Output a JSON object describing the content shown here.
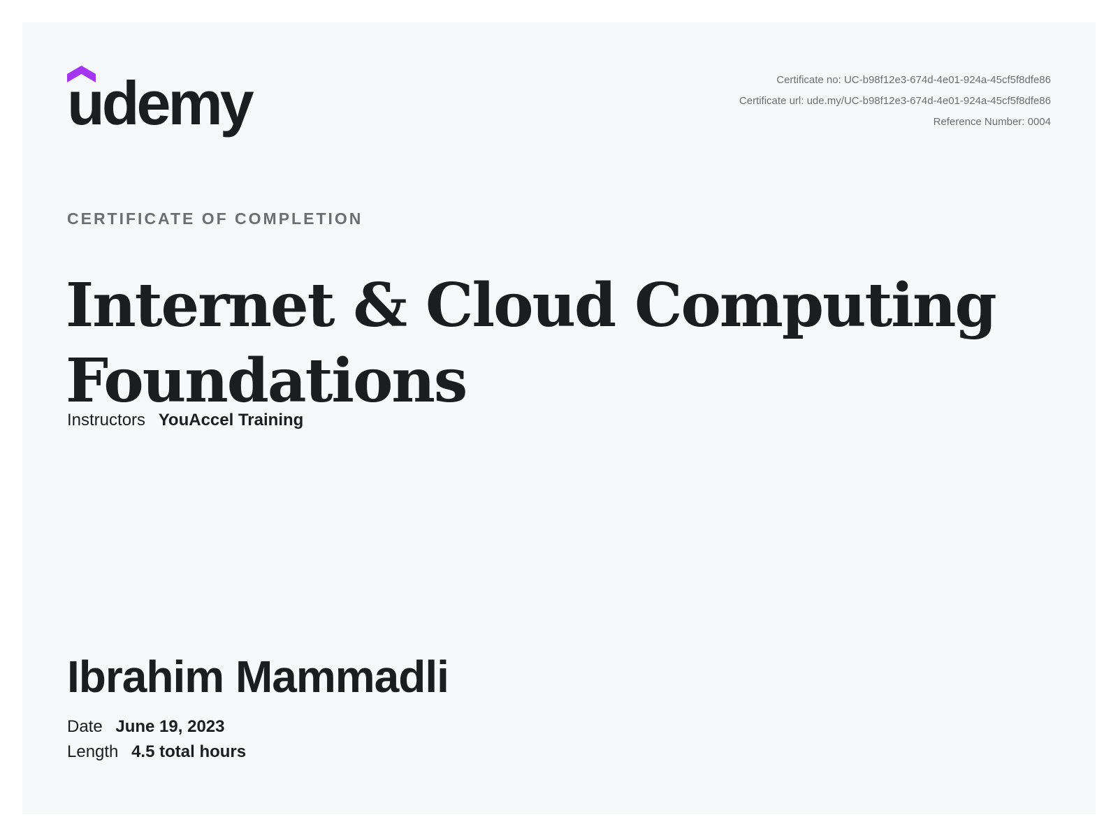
{
  "brand": {
    "logo_text": "udemy",
    "accent_color": "#a435f0"
  },
  "meta": {
    "certificate_no": "Certificate no: UC-b98f12e3-674d-4e01-924a-45cf5f8dfe86",
    "certificate_url": "Certificate url: ude.my/UC-b98f12e3-674d-4e01-924a-45cf5f8dfe86",
    "reference_number": "Reference Number: 0004"
  },
  "certificate": {
    "kicker": "CERTIFICATE OF COMPLETION",
    "course_title": "Internet & Cloud Computing Foundations",
    "instructors_label": "Instructors",
    "instructors_value": "YouAccel Training",
    "student_name": "Ibrahim Mammadli",
    "date_label": "Date",
    "date_value": "June 19, 2023",
    "length_label": "Length",
    "length_value": "4.5 total hours"
  }
}
